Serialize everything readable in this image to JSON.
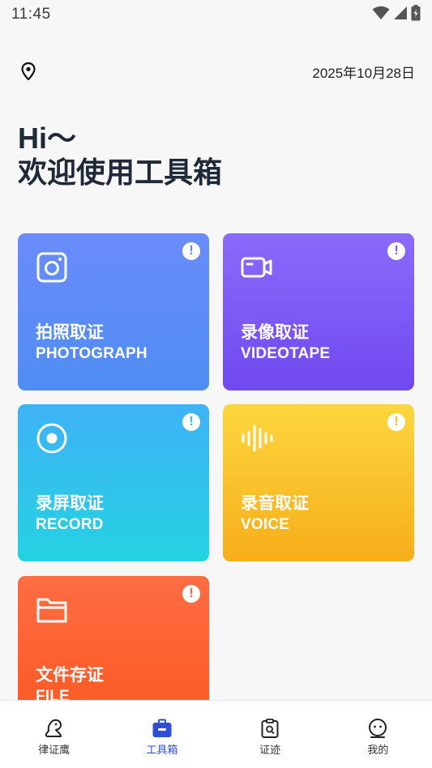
{
  "status_bar": {
    "time": "11:45",
    "icons": [
      "wifi-icon",
      "signal-icon",
      "battery-charging-icon"
    ]
  },
  "header": {
    "location_icon": "location-pin-icon",
    "date": "2025年10月28日"
  },
  "greeting": {
    "line1": "Hi～",
    "line2": "欢迎使用工具箱"
  },
  "cards": {
    "photo": {
      "icon": "camera-icon",
      "title": "拍照取证",
      "subtitle": "PHOTOGRAPH",
      "info_glyph": "!",
      "color": "#5b8cf8"
    },
    "video": {
      "icon": "video-camera-icon",
      "title": "录像取证",
      "subtitle": "VIDEOTAPE",
      "info_glyph": "!",
      "color": "#7c5af5"
    },
    "screen": {
      "icon": "record-icon",
      "title": "录屏取证",
      "subtitle": "RECORD",
      "info_glyph": "!",
      "color": "#2fc3ec"
    },
    "voice": {
      "icon": "sound-wave-icon",
      "title": "录音取证",
      "subtitle": "VOICE",
      "info_glyph": "!",
      "color": "#f9bf2b"
    },
    "file": {
      "icon": "folder-icon",
      "title": "文件存证",
      "subtitle": "FILE",
      "info_glyph": "!",
      "color": "#fd622f"
    }
  },
  "bottom_nav": {
    "items": [
      {
        "label": "律证鹰",
        "icon": "eagle-icon",
        "active": false
      },
      {
        "label": "工具箱",
        "icon": "toolbox-icon",
        "active": true
      },
      {
        "label": "证迹",
        "icon": "evidence-clipboard-icon",
        "active": false
      },
      {
        "label": "我的",
        "icon": "profile-face-icon",
        "active": false
      }
    ],
    "active_color": "#2d4fd8"
  }
}
